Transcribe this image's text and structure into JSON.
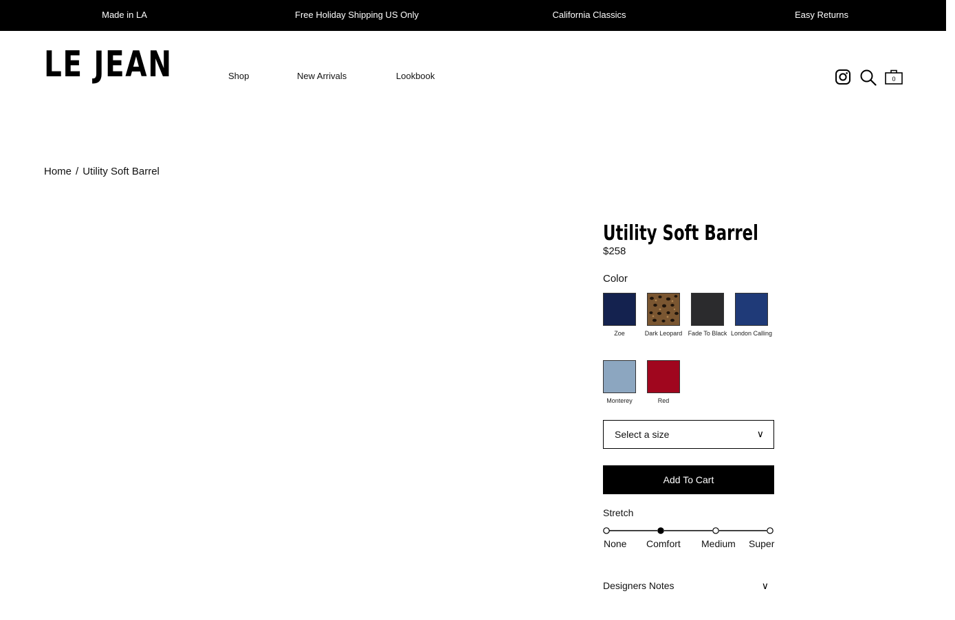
{
  "announcement_bar": {
    "items": [
      "Made in LA",
      "Free Holiday Shipping US Only",
      "California Classics",
      "Easy Returns"
    ]
  },
  "header": {
    "logo": "LE JEAN",
    "nav": [
      "Shop",
      "New Arrivals",
      "Lookbook"
    ],
    "icons": [
      "instagram-icon",
      "search-icon",
      "cart-icon"
    ],
    "cart_count": "0"
  },
  "breadcrumb": {
    "home": "Home",
    "separator": "/",
    "current": "Utility Soft Barrel"
  },
  "product": {
    "title": "Utility Soft Barrel",
    "price": "$258",
    "color_label": "Color",
    "colors": [
      {
        "name": "Zoe",
        "color": "#14224f"
      },
      {
        "name": "Dark Leopard",
        "color": "#6b4a2a"
      },
      {
        "name": "Fade To Black",
        "color": "#2b2b2d"
      },
      {
        "name": "London Calling",
        "color": "#1f3a78"
      },
      {
        "name": "Monterey",
        "color": "#8ca6c0"
      },
      {
        "name": "Red",
        "color": "#a0061e"
      }
    ],
    "size_placeholder": "Select a size",
    "dropdown_chevron": "∨",
    "add_to_cart": "Add To Cart",
    "stretch": {
      "label": "Stretch",
      "levels": [
        "None",
        "Comfort",
        "Medium",
        "Super"
      ],
      "selected": "Comfort"
    },
    "designers_notes": "Designers Notes"
  }
}
